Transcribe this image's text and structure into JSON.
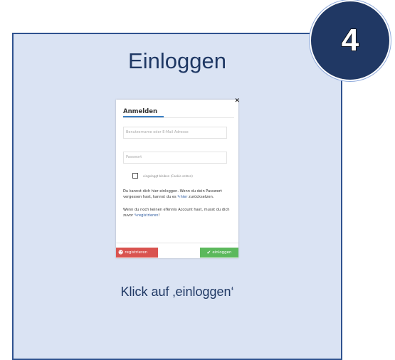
{
  "card": {
    "title": "Einloggen",
    "step_number": "4",
    "instruction": "Klick auf ‚einloggen‘"
  },
  "modal": {
    "heading": "Anmelden",
    "username_placeholder": "Benutzername oder E-Mail Adresse",
    "password_placeholder": "Passwort",
    "remember_label": "eingeloggt bleiben (Cookie setzen)",
    "paragraph1_before": "Du kannst dich hier einloggen. Wenn du dein Passwort vergessen hast, kannst du es ",
    "paragraph1_link": "hier",
    "paragraph1_after": " zurücksetzen.",
    "paragraph2_before": "Wenn du noch keinen eTennis Account hast, musst du dich zuvor ",
    "paragraph2_link": "registrieren",
    "paragraph2_after": "!",
    "register_button": "registrieren",
    "login_button": "einloggen"
  },
  "icons": {
    "close": "close-icon",
    "link": "link-icon",
    "user": "user-circle-icon",
    "check": "checkmark-icon"
  },
  "colors": {
    "card_background": "#dae3f3",
    "card_border": "#2f528f",
    "badge": "#203864",
    "link": "#2c5aa0",
    "register_button": "#d9534f",
    "login_button": "#5cb85c"
  }
}
